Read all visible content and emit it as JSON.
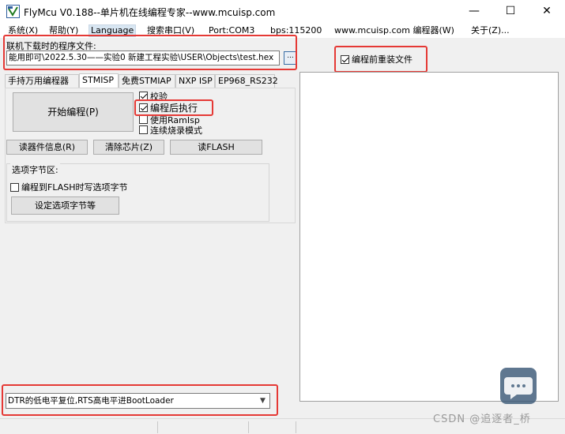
{
  "window": {
    "title": "FlyMcu V0.188--单片机在线编程专家--www.mcuisp.com",
    "controls": {
      "minimize": "—",
      "maximize": "☐",
      "close": "✕"
    }
  },
  "menu": [
    {
      "label": "系统(X)"
    },
    {
      "label": "帮助(Y)"
    },
    {
      "label": "Language"
    },
    {
      "label": "搜索串口(V)"
    },
    {
      "label": "Port:COM3"
    },
    {
      "label": "bps:115200"
    },
    {
      "label": "www.mcuisp.com 编程器(W)"
    },
    {
      "label": "关于(Z)..."
    }
  ],
  "file": {
    "label": "联机下载时的程序文件:",
    "path": "能用即可\\2022.5.30——实验0 新建工程实验\\USER\\Objects\\test.hex",
    "browse_label": "..."
  },
  "reload_option": {
    "label": "编程前重装文件",
    "checked": true
  },
  "tabs": [
    {
      "label": "手持万用编程器"
    },
    {
      "label": "STMISP"
    },
    {
      "label": "免费STMIAP"
    },
    {
      "label": "NXP ISP"
    },
    {
      "label": "EP968_RS232"
    }
  ],
  "stmisp": {
    "start_button": "开始编程(P)",
    "options": [
      {
        "label": "校验",
        "checked": true
      },
      {
        "label": "编程后执行",
        "checked": true
      },
      {
        "label": "使用RamIsp",
        "checked": false
      },
      {
        "label": "连续烧录模式",
        "checked": false
      }
    ],
    "read_info_button": "读器件信息(R)",
    "erase_button": "清除芯片(Z)",
    "read_flash_button": "读FLASH",
    "option_bytes": {
      "title": "选项字节区:",
      "write_checkbox": "编程到FLASH时写选项字节",
      "write_checked": false,
      "set_button": "设定选项字节等"
    }
  },
  "boot_mode": {
    "selected": "DTR的低电平复位,RTS高电平进BootLoader"
  },
  "watermark": "CSDN @追逐者_桥",
  "colors": {
    "highlight": "#e53935",
    "menu_active": "#d8e6f2"
  }
}
